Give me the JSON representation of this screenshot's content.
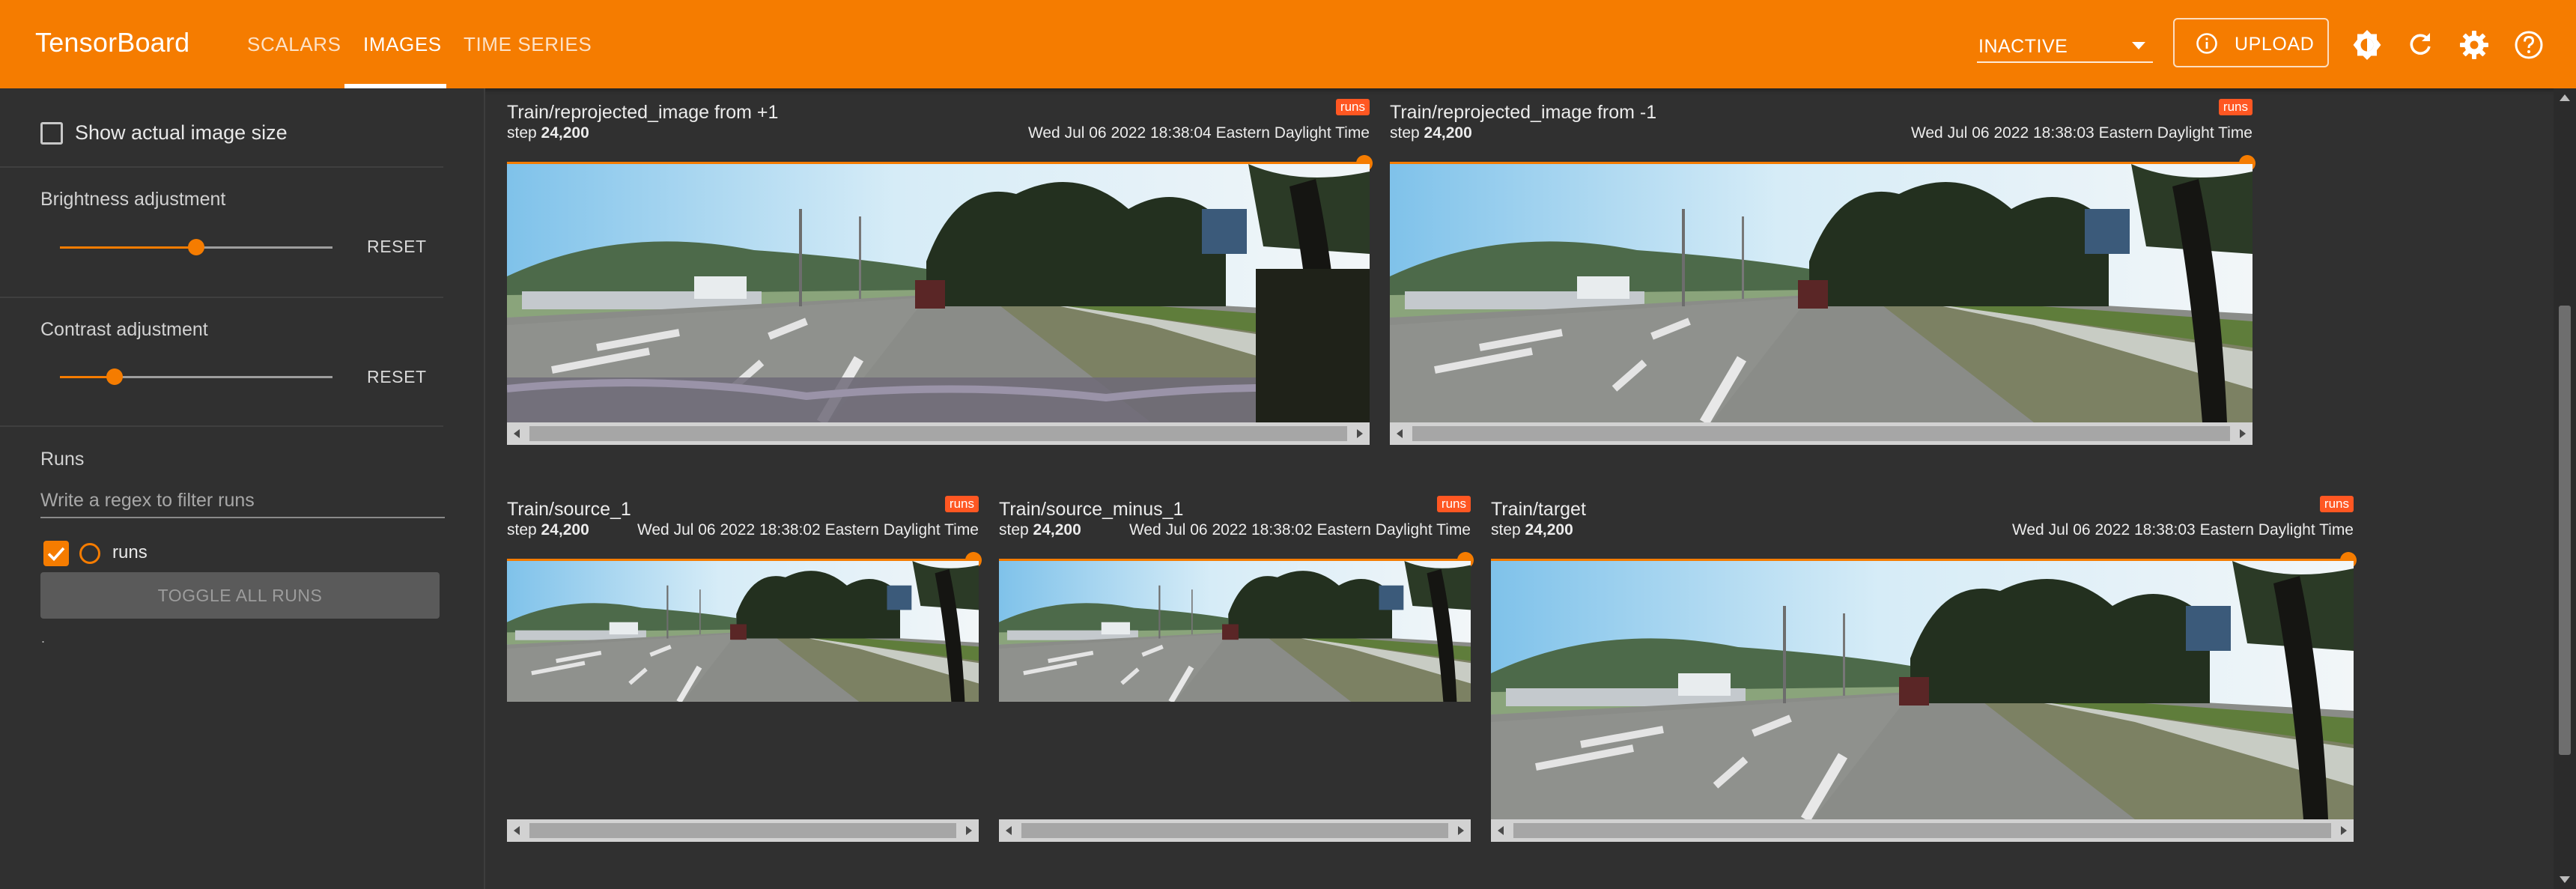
{
  "app": {
    "brand": "TensorBoard",
    "tabs": [
      {
        "label": "SCALARS"
      },
      {
        "label": "IMAGES",
        "active": true
      },
      {
        "label": "TIME SERIES"
      }
    ],
    "status_select": {
      "value": "INACTIVE"
    },
    "upload_label": "UPLOAD",
    "toolbar_icons": [
      "dark-mode-icon",
      "reload-icon",
      "settings-icon",
      "help-icon"
    ],
    "colors": {
      "accent": "#f57c00",
      "badge": "#ff5722",
      "background": "#303030"
    }
  },
  "sidebar": {
    "show_actual_size_label": "Show actual image size",
    "show_actual_size_checked": false,
    "brightness": {
      "label": "Brightness adjustment",
      "reset_label": "RESET",
      "level": 0.5
    },
    "contrast": {
      "label": "Contrast adjustment",
      "reset_label": "RESET",
      "level": 0.2
    },
    "runs": {
      "title": "Runs",
      "filter_placeholder": "Write a regex to filter runs",
      "items": [
        {
          "label": "runs",
          "checked": true
        }
      ],
      "toggle_all_label": "TOGGLE ALL RUNS",
      "footnote": "."
    }
  },
  "cards": [
    {
      "title": "Train/reprojected_image from +1",
      "run": "runs",
      "step_prefix": "step",
      "step": "24,200",
      "time": "Wed Jul 06 2022 18:38:04 Eastern Daylight Time"
    },
    {
      "title": "Train/reprojected_image from -1",
      "run": "runs",
      "step_prefix": "step",
      "step": "24,200",
      "time": "Wed Jul 06 2022 18:38:03 Eastern Daylight Time"
    },
    {
      "title": "Train/source_1",
      "run": "runs",
      "step_prefix": "step",
      "step": "24,200",
      "time": "Wed Jul 06 2022 18:38:02 Eastern Daylight Time"
    },
    {
      "title": "Train/source_minus_1",
      "run": "runs",
      "step_prefix": "step",
      "step": "24,200",
      "time": "Wed Jul 06 2022 18:38:02 Eastern Daylight Time"
    },
    {
      "title": "Train/target",
      "run": "runs",
      "step_prefix": "step",
      "step": "24,200",
      "time": "Wed Jul 06 2022 18:38:03 Eastern Daylight Time"
    }
  ]
}
